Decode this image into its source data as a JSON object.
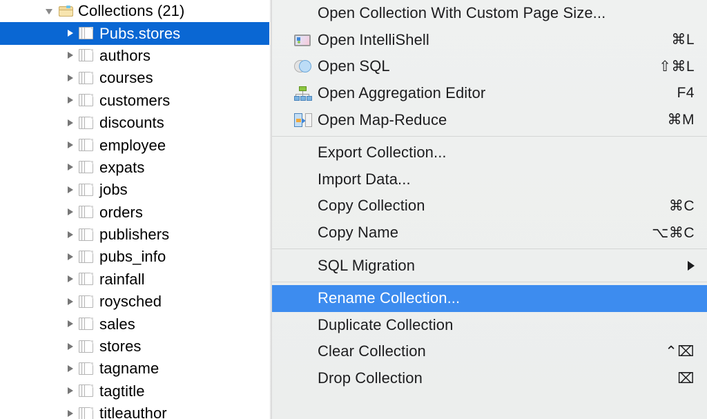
{
  "sidebar": {
    "root": {
      "label": "Collections (21)",
      "icon": "open-folder-icon",
      "expanded": true
    },
    "items": [
      {
        "label": "Pubs.stores",
        "selected": true
      },
      {
        "label": "authors",
        "selected": false
      },
      {
        "label": "courses",
        "selected": false
      },
      {
        "label": "customers",
        "selected": false
      },
      {
        "label": "discounts",
        "selected": false
      },
      {
        "label": "employee",
        "selected": false
      },
      {
        "label": "expats",
        "selected": false
      },
      {
        "label": "jobs",
        "selected": false
      },
      {
        "label": "orders",
        "selected": false
      },
      {
        "label": "publishers",
        "selected": false
      },
      {
        "label": "pubs_info",
        "selected": false
      },
      {
        "label": "rainfall",
        "selected": false
      },
      {
        "label": "roysched",
        "selected": false
      },
      {
        "label": "sales",
        "selected": false
      },
      {
        "label": "stores",
        "selected": false
      },
      {
        "label": "tagname",
        "selected": false
      },
      {
        "label": "tagtitle",
        "selected": false
      },
      {
        "label": "titleauthor",
        "selected": false
      }
    ],
    "selection_color": "#0a67d3"
  },
  "context_menu": {
    "highlight_color": "#3d8cef",
    "background_color": "#eef0ef",
    "sections": [
      {
        "items": [
          {
            "label": "Open Collection With Custom Page Size...",
            "shortcut": "",
            "icon": "",
            "highlighted": false,
            "submenu": false
          },
          {
            "label": "Open IntelliShell",
            "shortcut": "⌘L",
            "icon": "intellishell-icon",
            "highlighted": false,
            "submenu": false
          },
          {
            "label": "Open SQL",
            "shortcut": "⇧⌘L",
            "icon": "sql-venn-icon",
            "highlighted": false,
            "submenu": false
          },
          {
            "label": "Open Aggregation Editor",
            "shortcut": "F4",
            "icon": "aggregation-tree-icon",
            "highlighted": false,
            "submenu": false
          },
          {
            "label": "Open Map-Reduce",
            "shortcut": "⌘M",
            "icon": "map-reduce-icon",
            "highlighted": false,
            "submenu": false
          }
        ]
      },
      {
        "items": [
          {
            "label": "Export Collection...",
            "shortcut": "",
            "icon": "",
            "highlighted": false,
            "submenu": false
          },
          {
            "label": "Import Data...",
            "shortcut": "",
            "icon": "",
            "highlighted": false,
            "submenu": false
          },
          {
            "label": "Copy Collection",
            "shortcut": "⌘C",
            "icon": "",
            "highlighted": false,
            "submenu": false
          },
          {
            "label": "Copy Name",
            "shortcut": "⌥⌘C",
            "icon": "",
            "highlighted": false,
            "submenu": false
          }
        ]
      },
      {
        "items": [
          {
            "label": "SQL Migration",
            "shortcut": "",
            "icon": "",
            "highlighted": false,
            "submenu": true
          }
        ]
      },
      {
        "items": [
          {
            "label": "Rename Collection...",
            "shortcut": "",
            "icon": "",
            "highlighted": true,
            "submenu": false
          },
          {
            "label": "Duplicate Collection",
            "shortcut": "",
            "icon": "",
            "highlighted": false,
            "submenu": false
          },
          {
            "label": "Clear Collection",
            "shortcut": "⌃⌧",
            "icon": "",
            "highlighted": false,
            "submenu": false
          },
          {
            "label": "Drop Collection",
            "shortcut": "⌧",
            "icon": "",
            "highlighted": false,
            "submenu": false
          }
        ]
      }
    ]
  }
}
